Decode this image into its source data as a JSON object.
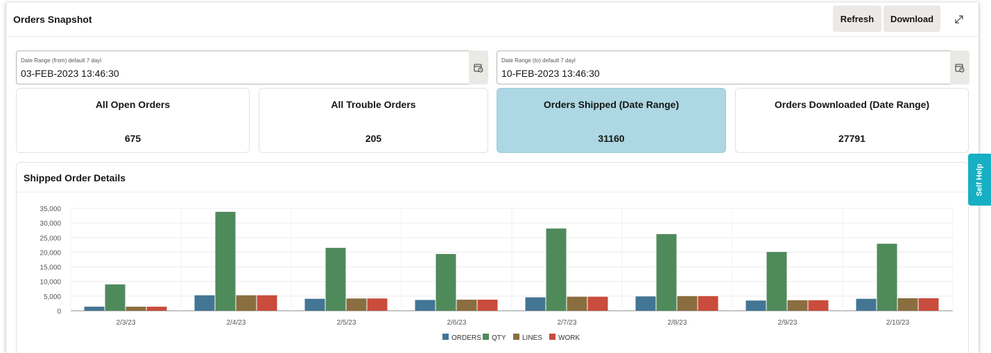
{
  "header": {
    "title": "Orders Snapshot",
    "refresh_label": "Refresh",
    "download_label": "Download"
  },
  "filters": {
    "from": {
      "label": "Date Range (from) default 7 dayl",
      "value": "03-FEB-2023 13:46:30"
    },
    "to": {
      "label": "Date Range (to) default 7 dayl",
      "value": "10-FEB-2023 13:46:30"
    }
  },
  "cards": [
    {
      "title": "All Open Orders",
      "value": "675",
      "selected": false
    },
    {
      "title": "All Trouble Orders",
      "value": "205",
      "selected": false
    },
    {
      "title": "Orders Shipped (Date Range)",
      "value": "31160",
      "selected": true
    },
    {
      "title": "Orders Downloaded (Date Range)",
      "value": "27791",
      "selected": false
    }
  ],
  "panel": {
    "title": "Shipped Order Details"
  },
  "self_help": "Self Help",
  "colors": {
    "ORDERS": "#437594",
    "QTY": "#4f8a5b",
    "LINES": "#8a6e3f",
    "WORK": "#c94c3c",
    "selected_card": "#acd7e3",
    "self_help": "#16afc4"
  },
  "chart_data": {
    "type": "bar",
    "categories": [
      "2/3/23",
      "2/4/23",
      "2/5/23",
      "2/6/23",
      "2/7/23",
      "2/8/23",
      "2/9/23",
      "2/10/23"
    ],
    "series": [
      {
        "name": "ORDERS",
        "values": [
          1400,
          5300,
          4100,
          3700,
          4600,
          4900,
          3500,
          4100
        ]
      },
      {
        "name": "QTY",
        "values": [
          9000,
          33800,
          21500,
          19400,
          28100,
          26200,
          20100,
          22900
        ]
      },
      {
        "name": "LINES",
        "values": [
          1400,
          5300,
          4200,
          3800,
          4800,
          5000,
          3600,
          4300
        ]
      },
      {
        "name": "WORK",
        "values": [
          1400,
          5300,
          4200,
          3800,
          4800,
          5000,
          3600,
          4300
        ]
      }
    ],
    "ylim": [
      0,
      35000
    ],
    "yticks": [
      "35,000",
      "30,000",
      "25,000",
      "20,000",
      "15,000",
      "10,000",
      "5,000",
      "0"
    ],
    "grid": true,
    "legend": "bottom-center"
  }
}
